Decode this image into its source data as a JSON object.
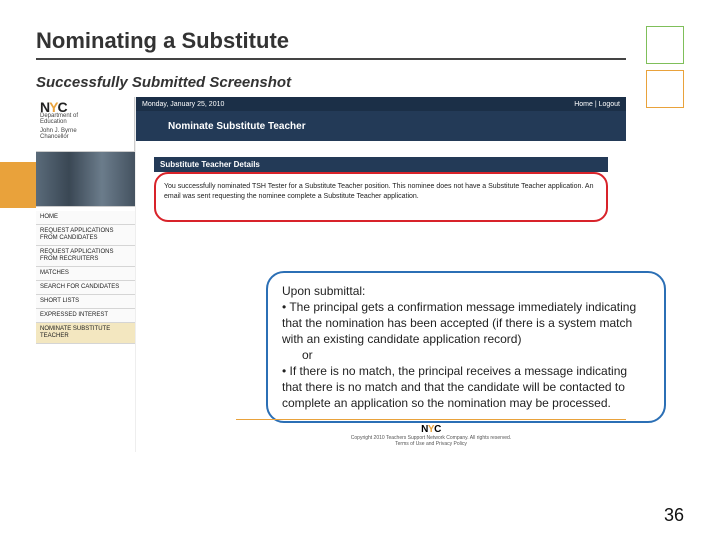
{
  "slide": {
    "title": "Nominating a Substitute",
    "subtitle": "Successfully Submitted Screenshot",
    "page_number": "36"
  },
  "app": {
    "topbar_left": "Monday, January 25, 2010",
    "topbar_right": "Home | Logout",
    "band_title": "Nominate Substitute Teacher",
    "logo_text": "NYC",
    "logo_sub1": "Department of",
    "logo_sub2": "Education",
    "logo_user": "John J. Byrne",
    "logo_role": "Chancellor",
    "panel_header": "Substitute Teacher Details",
    "success_msg": "You successfully nominated TSH Tester for a Substitute Teacher position. This nominee does not have a Substitute Teacher application. An email was sent requesting the nominee complete a Substitute Teacher application.",
    "nav": [
      "HOME",
      "REQUEST APPLICATIONS FROM CANDIDATES",
      "REQUEST APPLICATIONS FROM RECRUITERS",
      "MATCHES",
      "SEARCH FOR CANDIDATES",
      "SHORT LISTS",
      "EXPRESSED INTEREST",
      "NOMINATE SUBSTITUTE TEACHER"
    ],
    "footer_logo": "NYC",
    "footer_line1": "Copyright 2010 Teachers Support Network Company. All rights reserved.",
    "footer_line2": "Terms of Use and Privacy Policy"
  },
  "callout": {
    "l1": "Upon submittal:",
    "l2": "• The principal gets a confirmation message immediately indicating that the nomination has been accepted (if there is a system match with an existing candidate application record)",
    "l3": "or",
    "l4": "• If there is no match, the principal receives a message indicating that there is no match and that the candidate will be contacted to complete an application so the nomination may be processed."
  }
}
